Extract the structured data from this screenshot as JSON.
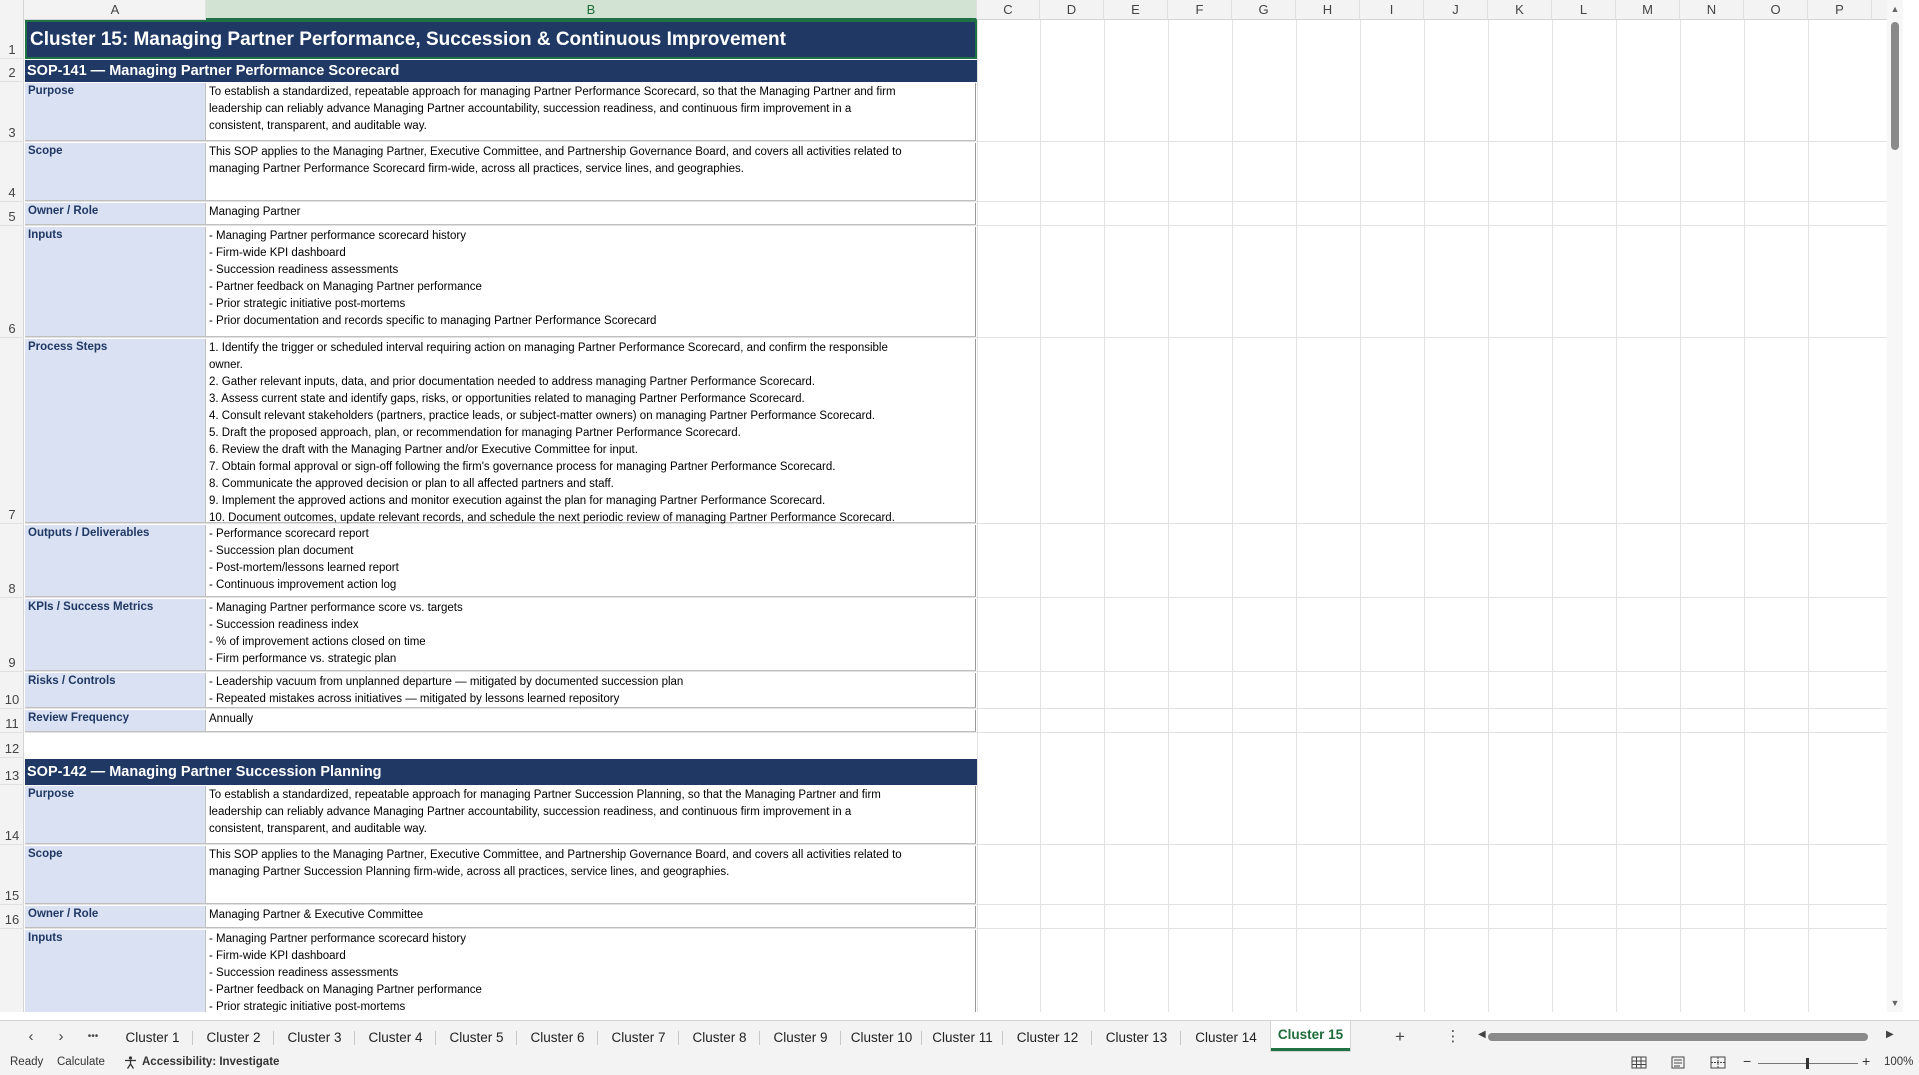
{
  "columns": [
    "A",
    "B",
    "C",
    "D",
    "E",
    "F",
    "G",
    "H",
    "I",
    "J",
    "K",
    "L",
    "M",
    "N",
    "O",
    "P"
  ],
  "selected_column": "B",
  "title": "Cluster 15: Managing Partner Performance, Succession & Continuous Improvement",
  "sop1": {
    "header": "SOP-141  —  Managing Partner Performance Scorecard",
    "purpose_label": "Purpose",
    "purpose": "To establish a standardized, repeatable approach for managing Partner Performance Scorecard, so that the Managing Partner and firm\nleadership can reliably advance Managing Partner accountability, succession readiness, and continuous firm improvement in a\nconsistent, transparent, and auditable way.",
    "scope_label": "Scope",
    "scope": "This SOP applies to the Managing Partner, Executive Committee, and Partnership Governance Board, and covers all activities related to\nmanaging Partner Performance Scorecard firm-wide, across all practices, service lines, and geographies.",
    "owner_label": "Owner / Role",
    "owner": "Managing Partner",
    "inputs_label": "Inputs",
    "inputs": "- Managing Partner performance scorecard history\n- Firm-wide KPI dashboard\n- Succession readiness assessments\n- Partner feedback on Managing Partner performance\n- Prior strategic initiative post-mortems\n- Prior documentation and records specific to managing Partner Performance Scorecard",
    "steps_label": "Process Steps",
    "steps": "1. Identify the trigger or scheduled interval requiring action on managing Partner Performance Scorecard, and confirm the responsible\nowner.\n2. Gather relevant inputs, data, and prior documentation needed to address managing Partner Performance Scorecard.\n3. Assess current state and identify gaps, risks, or opportunities related to managing Partner Performance Scorecard.\n4. Consult relevant stakeholders (partners, practice leads, or subject-matter owners) on managing Partner Performance Scorecard.\n5. Draft the proposed approach, plan, or recommendation for managing Partner Performance Scorecard.\n6. Review the draft with the Managing Partner and/or Executive Committee for input.\n7. Obtain formal approval or sign-off following the firm's governance process for managing Partner Performance Scorecard.\n8. Communicate the approved decision or plan to all affected partners and staff.\n9. Implement the approved actions and monitor execution against the plan for managing Partner Performance Scorecard.\n10. Document outcomes, update relevant records, and schedule the next periodic review of managing Partner Performance Scorecard.",
    "outputs_label": "Outputs / Deliverables",
    "outputs": "- Performance scorecard report\n- Succession plan document\n- Post-mortem/lessons learned report\n- Continuous improvement action log",
    "kpis_label": "KPIs / Success Metrics",
    "kpis": "- Managing Partner performance score vs. targets\n- Succession readiness index\n- % of improvement actions closed on time\n- Firm performance vs. strategic plan",
    "risks_label": "Risks / Controls",
    "risks": "- Leadership vacuum from unplanned departure — mitigated by documented succession plan\n- Repeated mistakes across initiatives — mitigated by lessons learned repository",
    "freq_label": "Review Frequency",
    "freq": "Annually"
  },
  "sop2": {
    "header": "SOP-142  —  Managing Partner Succession Planning",
    "purpose_label": "Purpose",
    "purpose": "To establish a standardized, repeatable approach for managing Partner Succession Planning, so that the Managing Partner and firm\nleadership can reliably advance Managing Partner accountability, succession readiness, and continuous firm improvement in a\nconsistent, transparent, and auditable way.",
    "scope_label": "Scope",
    "scope": "This SOP applies to the Managing Partner, Executive Committee, and Partnership Governance Board, and covers all activities related to\nmanaging Partner Succession Planning firm-wide, across all practices, service lines, and geographies.",
    "owner_label": "Owner / Role",
    "owner": "Managing Partner & Executive Committee",
    "inputs_label": "Inputs",
    "inputs": "- Managing Partner performance scorecard history\n- Firm-wide KPI dashboard\n- Succession readiness assessments\n- Partner feedback on Managing Partner performance\n- Prior strategic initiative post-mortems"
  },
  "tabs": [
    "Cluster 1",
    "Cluster 2",
    "Cluster 3",
    "Cluster 4",
    "Cluster 5",
    "Cluster 6",
    "Cluster 7",
    "Cluster 8",
    "Cluster 9",
    "Cluster 10",
    "Cluster 11",
    "Cluster 12",
    "Cluster 13",
    "Cluster 14",
    "Cluster 15"
  ],
  "active_tab": "Cluster 15",
  "tab_nav": {
    "prev": "‹",
    "next": "›",
    "more": "•••",
    "add": "+",
    "options": "⋮"
  },
  "status": {
    "ready": "Ready",
    "calculate": "Calculate",
    "accessibility": "Accessibility: Investigate",
    "zoom": "100%"
  },
  "colors": {
    "header_navy": "#1f3864",
    "label_bg": "#d9e1f2",
    "accent_green": "#1f7244"
  }
}
